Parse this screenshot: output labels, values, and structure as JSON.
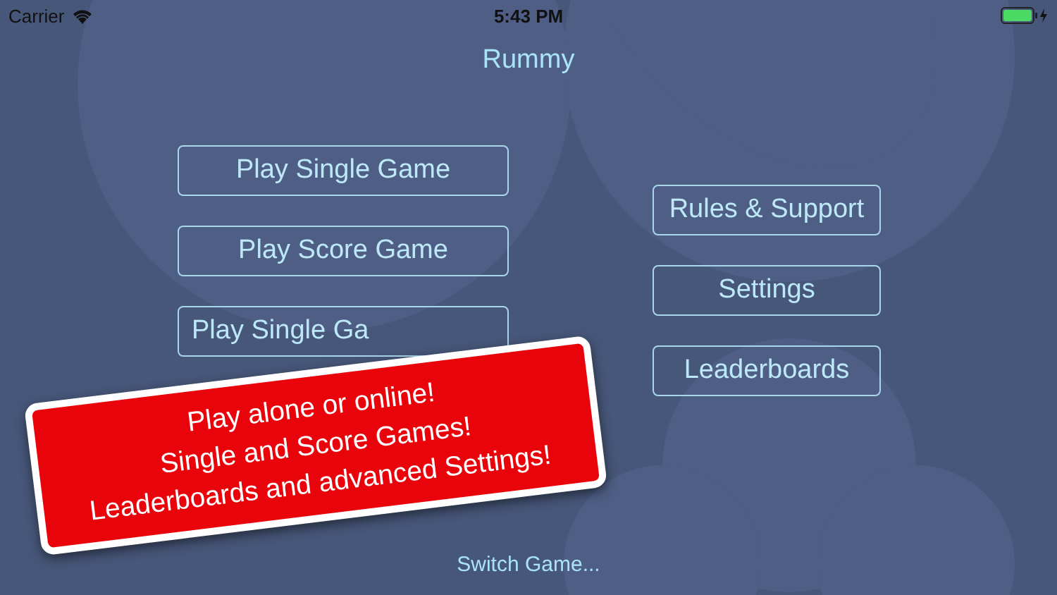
{
  "status_bar": {
    "carrier": "Carrier",
    "time": "5:43 PM"
  },
  "title": "Rummy",
  "left_buttons": [
    "Play Single Game",
    "Play Score Game",
    "Play Single Ga"
  ],
  "right_buttons": [
    "Rules & Support",
    "Settings",
    "Leaderboards"
  ],
  "banner": {
    "lines": [
      "Play alone or online!",
      "Single and Score Games!",
      "Leaderboards and advanced Settings!"
    ]
  },
  "footer_link": "Switch Game..."
}
